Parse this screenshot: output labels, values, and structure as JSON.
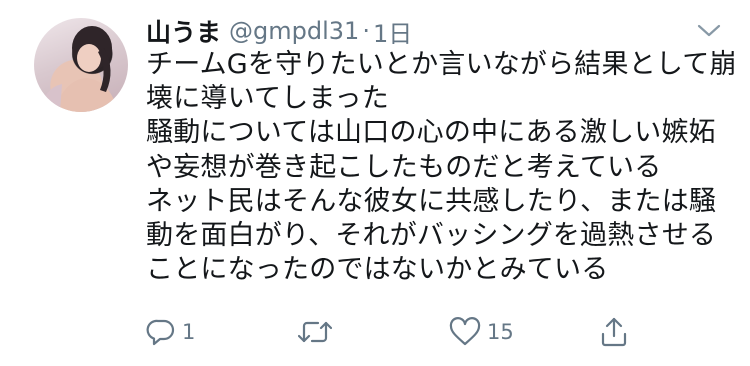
{
  "tweet": {
    "display_name": "山うま",
    "handle": "@gmpdl31",
    "separator": "·",
    "time": "1日",
    "text_lines": [
      "チームGを守りたいとか言いながら結果として崩",
      "壊に導いてしまった",
      "騒動については山口の心の中にある激しい嫉妬",
      "や妄想が巻き起こしたものだと考えている",
      "ネット民はそんな彼女に共感したり、または騒",
      "動を面白がり、それがバッシングを過熱させる",
      "ことになったのではないかとみている"
    ]
  },
  "actions": {
    "reply": {
      "icon": "reply-icon",
      "count": "1"
    },
    "retweet": {
      "icon": "retweet-icon",
      "count": ""
    },
    "like": {
      "icon": "heart-icon",
      "count": "15"
    },
    "share": {
      "icon": "share-icon",
      "count": ""
    }
  },
  "colors": {
    "text": "#14171a",
    "secondary": "#657786",
    "background": "#ffffff"
  }
}
